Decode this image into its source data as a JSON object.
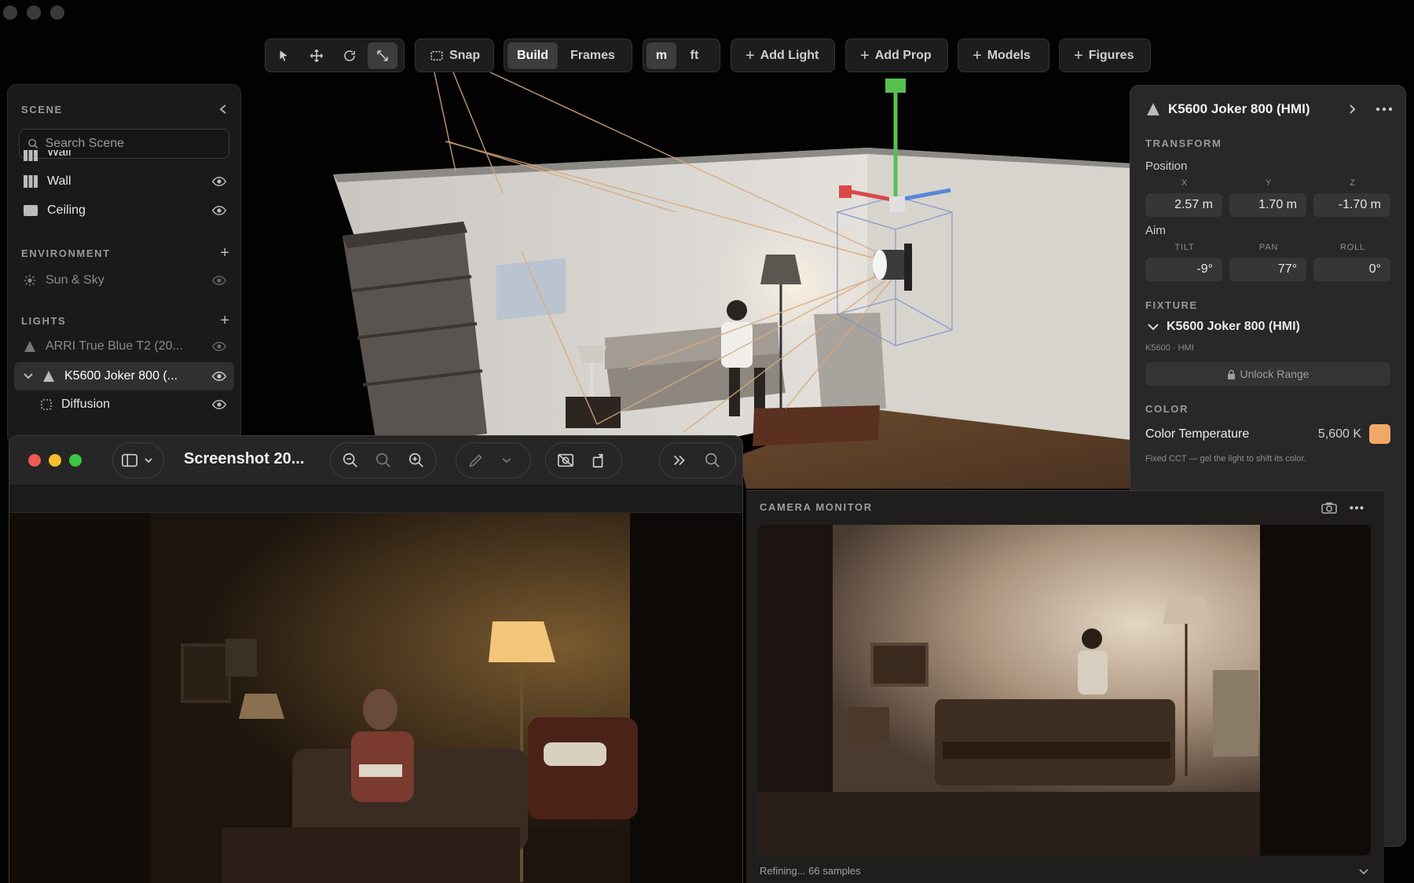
{
  "toolbar": {
    "snap_label": "Snap",
    "build_label": "Build",
    "frames_label": "Frames",
    "unit_m": "m",
    "unit_ft": "ft",
    "add_light": "Add Light",
    "add_prop": "Add Prop",
    "models": "Models",
    "figures": "Figures",
    "tools": [
      "select-arrow-icon",
      "move-icon",
      "rotate-icon",
      "scale-icon"
    ]
  },
  "scene": {
    "title": "SCENE",
    "search_placeholder": "Search Scene",
    "items": [
      {
        "label": "Wall",
        "icon": "wall-icon"
      },
      {
        "label": "Wall",
        "icon": "wall-icon"
      },
      {
        "label": "Ceiling",
        "icon": "ceiling-icon"
      }
    ],
    "environment_title": "ENVIRONMENT",
    "environment_items": [
      {
        "label": "Sun & Sky",
        "icon": "sun-icon"
      }
    ],
    "lights_title": "LIGHTS",
    "lights": [
      {
        "label": "ARRI True Blue T2 (20...",
        "icon": "light-cone-icon"
      },
      {
        "label": "K5600 Joker 800 (...",
        "icon": "light-cone-icon"
      },
      {
        "label": "Diffusion",
        "icon": "diffusion-icon"
      }
    ]
  },
  "props": {
    "title": "K5600 Joker 800 (HMI)",
    "transform_title": "TRANSFORM",
    "position_label": "Position",
    "axes": [
      "X",
      "Y",
      "Z"
    ],
    "position": [
      "2.57 m",
      "1.70 m",
      "-1.70 m"
    ],
    "aim_label": "Aim",
    "aim_axes": [
      "TILT",
      "PAN",
      "ROLL"
    ],
    "aim": [
      "-9°",
      "77°",
      "0°"
    ],
    "fixture_title": "FIXTURE",
    "fixture_name": "K5600 Joker 800 (HMI)",
    "fixture_sub": "K5600 · HMI",
    "unlock_label": "Unlock Range",
    "color_title": "COLOR",
    "color_temp_label": "Color Temperature",
    "color_temp_value": "5,600 K",
    "color_swatch": "#f0a868",
    "color_note": "Fixed CCT — gel the light to shift its color."
  },
  "viewer": {
    "title": "Screenshot 20...",
    "dots": [
      "#ee5a52",
      "#f4be30",
      "#3ec542"
    ]
  },
  "monitor": {
    "title": "CAMERA MONITOR",
    "status": "Refining... 66 samples"
  }
}
